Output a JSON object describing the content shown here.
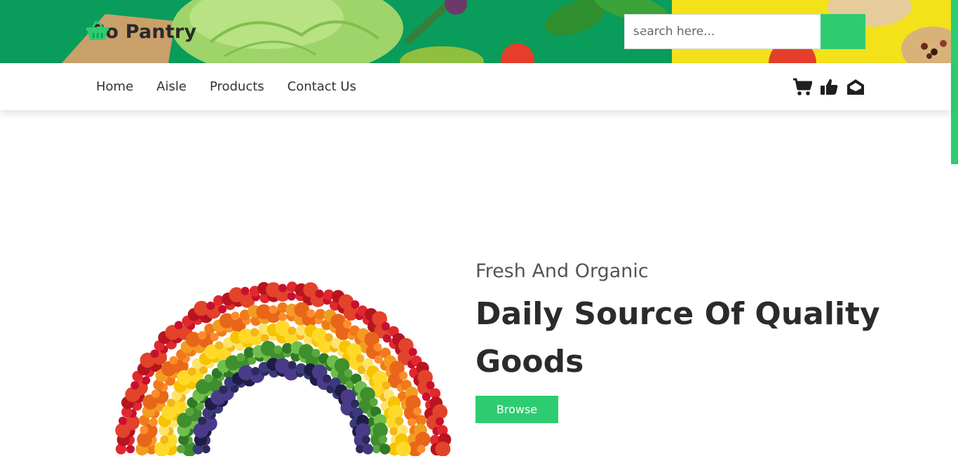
{
  "banner": {
    "logo_text": "Go Pantry",
    "logo_icon": "basket-icon"
  },
  "search": {
    "placeholder": "search here...",
    "value": "",
    "button_icon": "search-icon"
  },
  "nav": {
    "links": [
      "Home",
      "Aisle",
      "Products",
      "Contact Us"
    ],
    "icons": [
      "cart-icon",
      "thumbs-up-icon",
      "envelope-open-icon"
    ]
  },
  "hero": {
    "subtitle": "Fresh And Organic",
    "title": "Daily Source Of Quality Goods",
    "button_label": "Browse",
    "image_icon": "rainbow-produce-image"
  },
  "colors": {
    "accent": "#2ecc71",
    "text_dark": "#2b2b2b",
    "banner_green": "#0a9c5a",
    "banner_yellow": "#f3e11a"
  }
}
